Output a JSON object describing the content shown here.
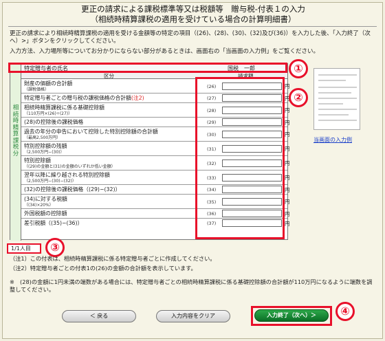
{
  "header": {
    "title_line1": "更正の請求による課税標準等又は税額等　贈与税-付表１の入力",
    "title_line2": "（相続時精算課税の適用を受けている場合の計算明細書）"
  },
  "intro": {
    "line1": "更正の請求により相続時精算課税の適用を受ける金額等の特定の項目（(26)、(28)、(30)、(32)及び(36)）を入力した後、「入力終了（次へ）>」ボタンをクリックしてください。",
    "line2": "入力方法、入力場所等についてお分かりにならない部分があるときは、画面右の「当画面の入力例」をご覧ください。"
  },
  "form": {
    "side_label": "相続時精算課税分",
    "donor_label": "特定贈与者の氏名",
    "donor_value": "国税　一郎",
    "col_category": "区分",
    "col_amount": "請求額",
    "yen": "円",
    "rows": [
      {
        "label": "財産の価額の合計額",
        "sub": "（課税価格）",
        "num": "(26)"
      },
      {
        "label": "特定贈与者ごとの贈与税の課税価格の合計額",
        "note": "(注2)",
        "num": "(27)"
      },
      {
        "label": "相続時精算課税に係る基礎控除額",
        "sub": "（110万円×(26)÷(27)）",
        "num": "(28)"
      },
      {
        "label": "(28)の控除後の課税価格",
        "num": "(29)"
      },
      {
        "label": "過去の年分の申告において控除した特別控除額の合計額",
        "sub": "（最高2,500万円）",
        "num": "(30)"
      },
      {
        "label": "特別控除額の残額",
        "sub": "（2,500万円−(30)）",
        "num": "(31)"
      },
      {
        "label": "特別控除額",
        "sub": "（(29)の金額と(31)の金額のいずれか低い金額）",
        "num": "(32)"
      },
      {
        "label": "翌年以降に繰り越される特別控除額",
        "sub": "（2,500万円−(30)−(32)）",
        "num": "(33)"
      },
      {
        "label": "(32)の控除後の課税価格（(29)−(32)）",
        "num": "(34)"
      },
      {
        "label": "(34)に対する税額",
        "sub": "（(34)×20%）",
        "num": "(35)"
      },
      {
        "label": "外国税額の控除額",
        "num": "(36)"
      },
      {
        "label": "差引税額（(35)−(36)）",
        "num": "(37)"
      }
    ]
  },
  "side_panel": {
    "example_link": "当画面の入力例"
  },
  "pager": {
    "text": "1/1人目"
  },
  "notes": {
    "note1": "（注1）この付表は、相続時精算課税に係る特定贈与者ごとに作成してください。",
    "note2": "（注2）特定贈与者ごとの付表1の(26)の金額の合計額を表示しています。",
    "note3": "※　(28)の金額に1円未満の端数がある場合には、特定贈与者ごとの相続時精算課税に係る基礎控除額の合計額が110万円になるように端数を調整してください。"
  },
  "buttons": {
    "back": "＜ 戻る",
    "clear": "入力内容をクリア",
    "next": "入力終了（次へ）＞"
  },
  "callouts": [
    "①",
    "②",
    "③",
    "④"
  ],
  "colors": {
    "accent_red": "#e8102a",
    "next_button_green": "#0a6f26",
    "side_label_green": "#2b8a3e",
    "link_blue": "#1a3fc9"
  }
}
